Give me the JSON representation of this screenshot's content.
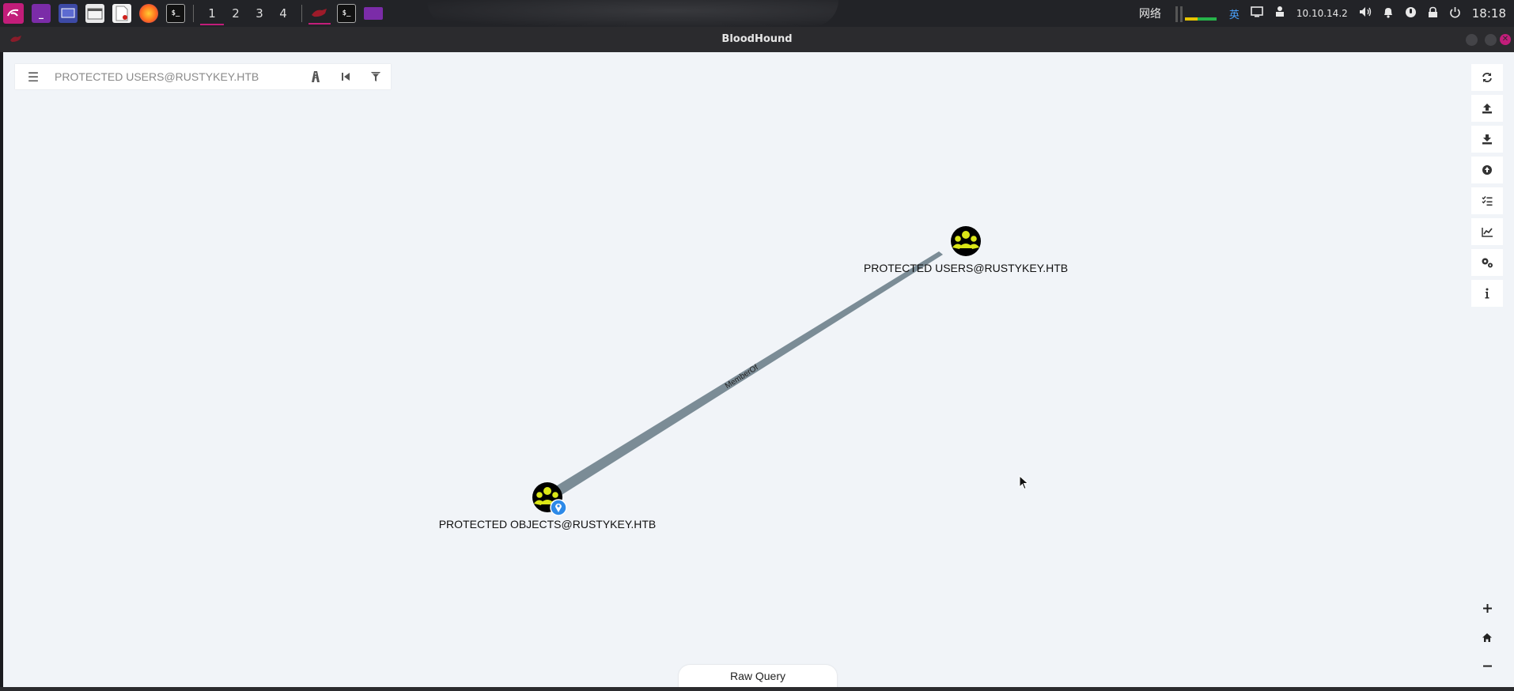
{
  "taskbar": {
    "workspaces": [
      "1",
      "2",
      "3",
      "4"
    ],
    "active_workspace": "1",
    "network_label": "网络",
    "ime": "英",
    "ip": "10.10.14.2",
    "time": "18:18",
    "icons": [
      "kali-menu-icon",
      "terminal-icon",
      "screenshot-icon",
      "file-manager-icon",
      "text-editor-icon",
      "firefox-icon",
      "terminal-black-icon",
      "bloodhound-app-icon",
      "terminal-app-icon",
      "folder-app-icon",
      "display-icon",
      "vpn-icon",
      "volume-icon",
      "bell-icon",
      "mic-icon",
      "lock-icon",
      "power-icon"
    ]
  },
  "window": {
    "title": "BloodHound"
  },
  "search": {
    "placeholder": "PROTECTED USERS@RUSTYKEY.HTB"
  },
  "graph": {
    "nodes": [
      {
        "id": "users",
        "label": "PROTECTED USERS@RUSTYKEY.HTB",
        "type": "Group",
        "starting": false
      },
      {
        "id": "objects",
        "label": "PROTECTED OBJECTS@RUSTYKEY.HTB",
        "type": "Group",
        "starting": true
      }
    ],
    "edges": [
      {
        "from": "objects",
        "to": "users",
        "label": "MemberOf"
      }
    ],
    "colors": {
      "group_fill": "#dbe617",
      "node_bg": "#000000",
      "edge": "#7b8c96",
      "pin": "#2d8ae8"
    }
  },
  "toolbar": {
    "buttons": [
      "refresh-icon",
      "upload-icon",
      "download-icon",
      "import-icon",
      "queries-icon",
      "chart-icon",
      "settings-icon",
      "info-icon"
    ]
  },
  "zoom": {
    "buttons": [
      "zoom-in-icon",
      "home-icon",
      "zoom-out-icon"
    ]
  },
  "raw_query": {
    "label": "Raw Query"
  }
}
